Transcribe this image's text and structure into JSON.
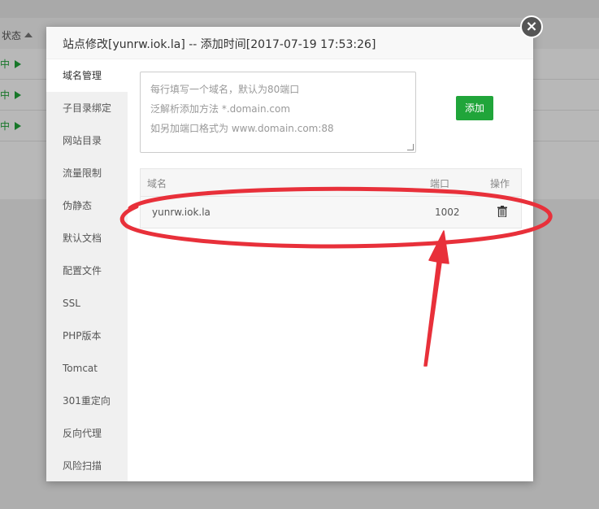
{
  "background": {
    "column_status": "状态",
    "rows": [
      {
        "text": "中"
      },
      {
        "text": "中"
      },
      {
        "text": "中"
      }
    ]
  },
  "modal": {
    "title": "站点修改[yunrw.iok.la] -- 添加时间[2017-07-19 17:53:26]",
    "close_label": "×",
    "sidebar": {
      "items": [
        {
          "label": "域名管理",
          "active": true
        },
        {
          "label": "子目录绑定"
        },
        {
          "label": "网站目录"
        },
        {
          "label": "流量限制"
        },
        {
          "label": "伪静态"
        },
        {
          "label": "默认文档"
        },
        {
          "label": "配置文件"
        },
        {
          "label": "SSL"
        },
        {
          "label": "PHP版本"
        },
        {
          "label": "Tomcat"
        },
        {
          "label": "301重定向"
        },
        {
          "label": "反向代理"
        },
        {
          "label": "风险扫描"
        }
      ]
    },
    "domain_input": {
      "placeholder_line1": "每行填写一个域名，默认为80端口",
      "placeholder_line2": "泛解析添加方法 *.domain.com",
      "placeholder_line3": "如另加端口格式为 www.domain.com:88"
    },
    "add_button": "添加",
    "table": {
      "headers": {
        "domain": "域名",
        "port": "端口",
        "action": "操作"
      },
      "rows": [
        {
          "domain": "yunrw.iok.la",
          "port": "1002",
          "action_icon": "trash-icon"
        }
      ]
    }
  },
  "colors": {
    "accent_green": "#20a53a",
    "annotation_red": "#e8303a"
  }
}
